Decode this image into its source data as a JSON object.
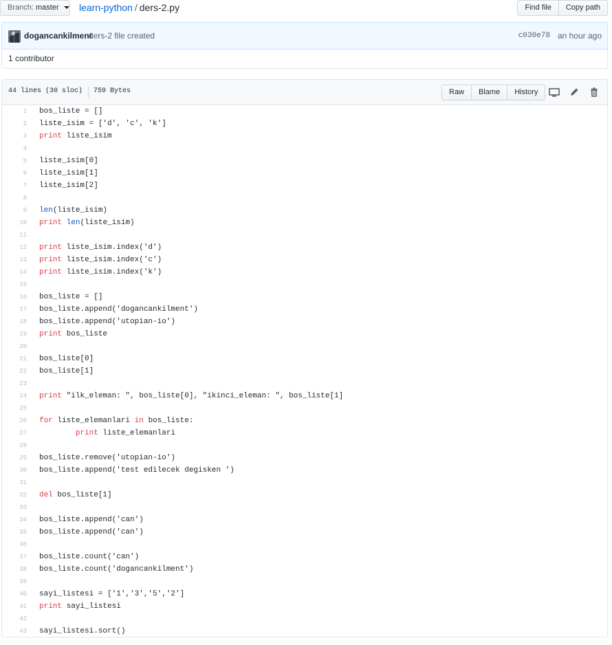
{
  "header": {
    "branch_prefix": "Branch:",
    "branch_name": "master",
    "repo": "learn-python",
    "separator": "/",
    "file": "ders-2.py",
    "find_file": "Find file",
    "copy_path": "Copy path"
  },
  "commit": {
    "author": "dogancankilment",
    "message": "ders-2 file created",
    "sha": "c030e78",
    "time_ago": "an hour ago"
  },
  "contributors": "1 contributor",
  "file_header": {
    "lines_info": "44 lines (30 sloc)",
    "size": "759 Bytes",
    "raw": "Raw",
    "blame": "Blame",
    "history": "History",
    "icons": [
      "desktop-icon",
      "pencil-icon",
      "trash-icon"
    ]
  },
  "code": {
    "lines": [
      {
        "n": "1",
        "t": "bos_liste = []"
      },
      {
        "n": "2",
        "t": "liste_isim = ['d', 'c', 'k']"
      },
      {
        "n": "3",
        "t": "print liste_isim"
      },
      {
        "n": "4",
        "t": ""
      },
      {
        "n": "5",
        "t": "liste_isim[0]"
      },
      {
        "n": "6",
        "t": "liste_isim[1]"
      },
      {
        "n": "7",
        "t": "liste_isim[2]"
      },
      {
        "n": "8",
        "t": ""
      },
      {
        "n": "9",
        "t": "len(liste_isim)"
      },
      {
        "n": "10",
        "t": "print len(liste_isim)"
      },
      {
        "n": "11",
        "t": ""
      },
      {
        "n": "12",
        "t": "print liste_isim.index('d')"
      },
      {
        "n": "13",
        "t": "print liste_isim.index('c')"
      },
      {
        "n": "14",
        "t": "print liste_isim.index('k')"
      },
      {
        "n": "15",
        "t": ""
      },
      {
        "n": "16",
        "t": "bos_liste = []"
      },
      {
        "n": "17",
        "t": "bos_liste.append('dogancankilment')"
      },
      {
        "n": "18",
        "t": "bos_liste.append('utopian-io')"
      },
      {
        "n": "19",
        "t": "print bos_liste"
      },
      {
        "n": "20",
        "t": ""
      },
      {
        "n": "21",
        "t": "bos_liste[0]"
      },
      {
        "n": "22",
        "t": "bos_liste[1]"
      },
      {
        "n": "23",
        "t": ""
      },
      {
        "n": "24",
        "t": "print \"ilk_eleman: \", bos_liste[0], \"ikinci_eleman: \", bos_liste[1]"
      },
      {
        "n": "25",
        "t": ""
      },
      {
        "n": "26",
        "t": "for liste_elemanlari in bos_liste:"
      },
      {
        "n": "27",
        "t": "        print liste_elemanlari"
      },
      {
        "n": "28",
        "t": ""
      },
      {
        "n": "29",
        "t": "bos_liste.remove('utopian-io')"
      },
      {
        "n": "30",
        "t": "bos_liste.append('test edilecek degisken ')"
      },
      {
        "n": "31",
        "t": ""
      },
      {
        "n": "32",
        "t": "del bos_liste[1]"
      },
      {
        "n": "33",
        "t": ""
      },
      {
        "n": "34",
        "t": "bos_liste.append('can')"
      },
      {
        "n": "35",
        "t": "bos_liste.append('can')"
      },
      {
        "n": "36",
        "t": ""
      },
      {
        "n": "37",
        "t": "bos_liste.count('can')"
      },
      {
        "n": "38",
        "t": "bos_liste.count('dogancankilment')"
      },
      {
        "n": "39",
        "t": ""
      },
      {
        "n": "40",
        "t": "sayi_listesi = ['1','3','5','2']"
      },
      {
        "n": "41",
        "t": "print sayi_listesi"
      },
      {
        "n": "42",
        "t": ""
      },
      {
        "n": "43",
        "t": "sayi_listesi.sort()"
      }
    ]
  }
}
